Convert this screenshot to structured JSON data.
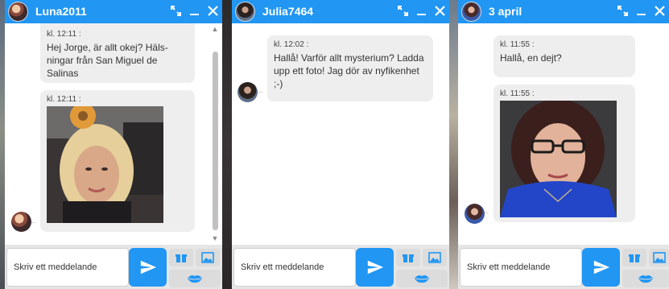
{
  "colors": {
    "accent": "#2196f3",
    "bubble": "#eeeeee",
    "input_bar": "#e6e6e6"
  },
  "windows": [
    {
      "title": "Luna2011",
      "messages": [
        {
          "time": "kl. 12:11 :",
          "lines": [
            "Hej Jorge, är allt okej? Häls-",
            "ningar från San Miguel de",
            "Salinas"
          ]
        },
        {
          "time": "kl. 12:11 :",
          "image": "profile-photo"
        }
      ],
      "input_placeholder": "Skriv ett meddelande"
    },
    {
      "title": "Julia7464",
      "messages": [
        {
          "time": "kl. 12:02 :",
          "lines": [
            "Hallå! Varför allt mysterium? Ladda",
            "upp ett foto! Jag dör av nyfikenhet",
            ";-)"
          ]
        }
      ],
      "input_placeholder": "Skriv ett meddelande"
    },
    {
      "title": "3 april",
      "messages": [
        {
          "time": "kl. 11:55 :",
          "lines": [
            "Hallå, en dejt?"
          ]
        },
        {
          "time": "kl. 11:55 :",
          "image": "profile-photo"
        }
      ],
      "input_placeholder": "Skriv ett meddelande"
    }
  ],
  "icons": {
    "expand": "expand-icon",
    "minimize": "minimize-icon",
    "close": "close-icon",
    "send": "send-icon",
    "gift": "gift-icon",
    "image": "image-icon",
    "kiss": "lips-icon"
  }
}
